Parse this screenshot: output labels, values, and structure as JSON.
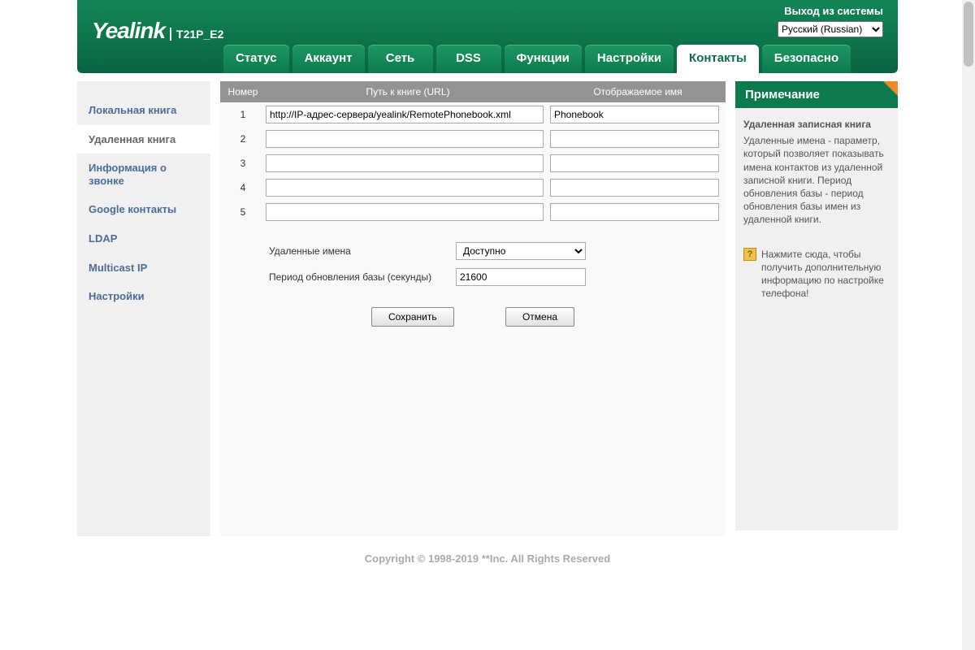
{
  "header": {
    "logout": "Выход из системы",
    "lang": {
      "selected": "Русский (Russian)"
    },
    "logo": "Yealink",
    "model": "T21P_E2"
  },
  "tabs": [
    {
      "label": "Статус",
      "active": false
    },
    {
      "label": "Аккаунт",
      "active": false
    },
    {
      "label": "Сеть",
      "active": false
    },
    {
      "label": "DSS",
      "active": false
    },
    {
      "label": "Функции",
      "active": false
    },
    {
      "label": "Настройки",
      "active": false
    },
    {
      "label": "Контакты",
      "active": true
    },
    {
      "label": "Безопасно",
      "active": false
    }
  ],
  "sidebar": {
    "items": [
      {
        "label": "Локальная книга",
        "active": false
      },
      {
        "label": "Удаленная книга",
        "active": true
      },
      {
        "label": "Информация о звонке",
        "active": false
      },
      {
        "label": "Google контакты",
        "active": false
      },
      {
        "label": "LDAP",
        "active": false
      },
      {
        "label": "Multicast IP",
        "active": false
      },
      {
        "label": "Настройки",
        "active": false
      }
    ]
  },
  "table": {
    "headers": {
      "num": "Номер",
      "url": "Путь к книге (URL)",
      "name": "Отображаемое имя"
    },
    "rows": [
      {
        "num": "1",
        "url": "http://IP-адрес-сервера/yealink/RemotePhonebook.xml",
        "name": "Phonebook"
      },
      {
        "num": "2",
        "url": "",
        "name": ""
      },
      {
        "num": "3",
        "url": "",
        "name": ""
      },
      {
        "num": "4",
        "url": "",
        "name": ""
      },
      {
        "num": "5",
        "url": "",
        "name": ""
      }
    ]
  },
  "params": {
    "remote_names_label": "Удаленные имена",
    "remote_names_value": "Доступно",
    "refresh_label": "Период обновления базы (секунды)",
    "refresh_value": "21600"
  },
  "buttons": {
    "save": "Сохранить",
    "cancel": "Отмена"
  },
  "note": {
    "title": "Примечание",
    "heading": "Удаленная записная книга",
    "text": "Удаленные имена - параметр, который позволяет показывать имена контактов из удаленной записной книги. Период обновления базы - период обновления базы имен из удаленной книги.",
    "hint_icon": "?",
    "hint": "Нажмите сюда, чтобы получить дополнительную информацию по настройке телефона!"
  },
  "footer": "Copyright © 1998-2019 **Inc. All Rights Reserved"
}
